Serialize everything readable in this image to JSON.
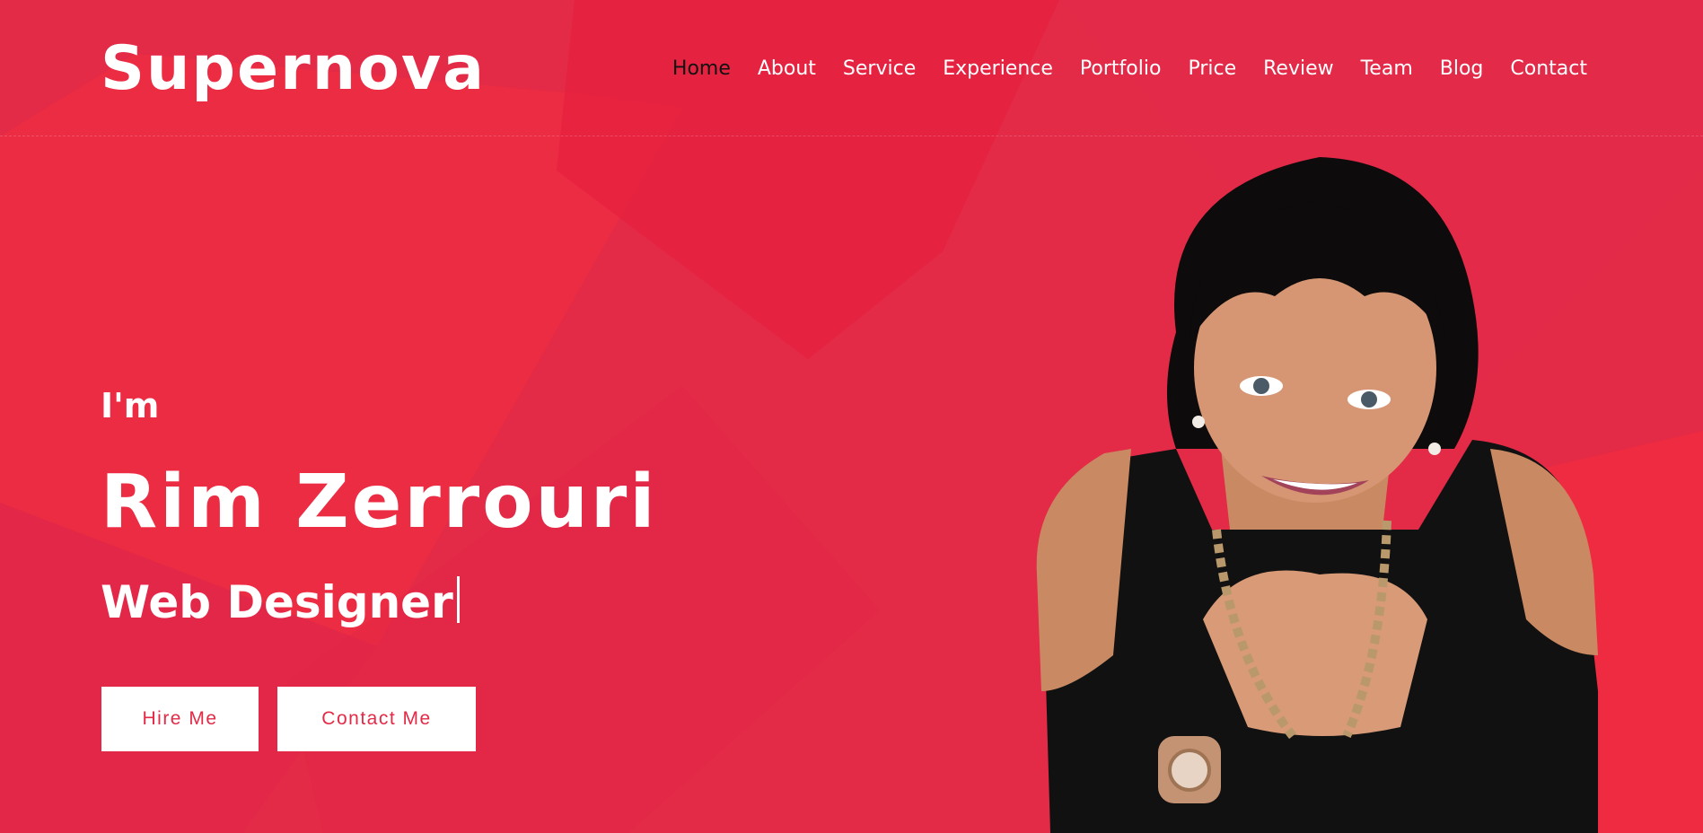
{
  "brand": "Supernova",
  "nav": {
    "items": [
      {
        "label": "Home",
        "active": true
      },
      {
        "label": "About"
      },
      {
        "label": "Service"
      },
      {
        "label": "Experience"
      },
      {
        "label": "Portfolio"
      },
      {
        "label": "Price"
      },
      {
        "label": "Review"
      },
      {
        "label": "Team"
      },
      {
        "label": "Blog"
      },
      {
        "label": "Contact"
      }
    ]
  },
  "hero": {
    "greeting": "I'm",
    "name": "Rim Zerrouri",
    "role": "Web Designer",
    "buttons": {
      "hire": "Hire Me",
      "contact": "Contact Me"
    }
  },
  "colors": {
    "background": "#e32a46",
    "button_text": "#e32a46",
    "active_nav": "#111111",
    "text": "#ffffff"
  }
}
